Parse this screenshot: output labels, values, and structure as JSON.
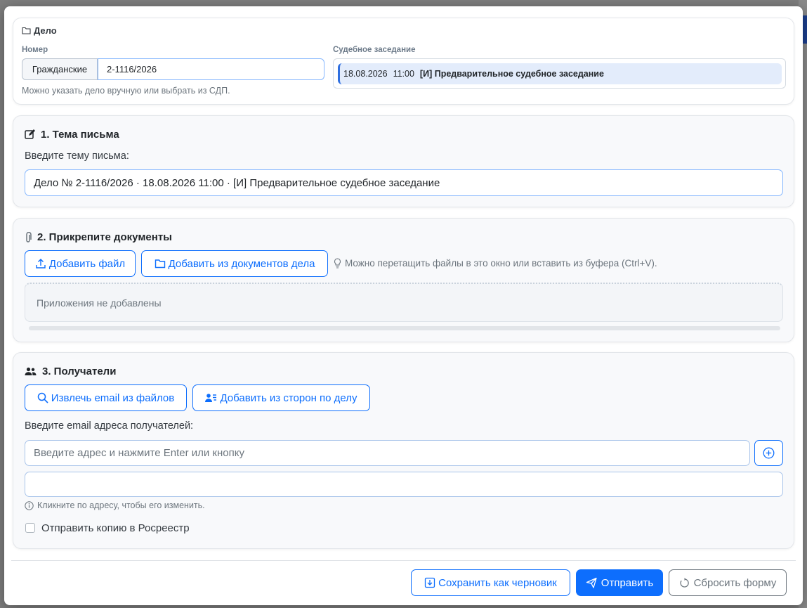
{
  "case": {
    "title": "Дело",
    "number_label": "Номер",
    "case_type": "Гражданские",
    "case_number": "2-1116/2026",
    "hint": "Можно указать дело вручную или выбрать из СДП.",
    "hearing_label": "Судебное заседание",
    "hearing": {
      "date": "18.08.2026",
      "time": "11:00",
      "name": "[И] Предварительное судебное заседание"
    }
  },
  "subject": {
    "title": "1. Тема письма",
    "label": "Введите тему письма:",
    "value": "Дело № 2-1116/2026 · 18.08.2026 11:00 · [И] Предварительное судебное заседание"
  },
  "attachments": {
    "title": "2. Прикрепите документы",
    "add_file": "Добавить файл",
    "add_from_case": "Добавить из документов дела",
    "tip": "Можно перетащить файлы в это окно или вставить из буфера (Ctrl+V).",
    "empty": "Приложения не добавлены"
  },
  "recipients": {
    "title": "3. Получатели",
    "extract_email": "Извлечь email из файлов",
    "add_from_parties": "Добавить из сторон по делу",
    "label": "Введите email адреса получателей:",
    "placeholder": "Введите адрес и нажмите Enter или кнопку",
    "edit_hint": "Кликните по адресу, чтобы его изменить.",
    "rosreestr": "Отправить копию в Росреестр"
  },
  "footer": {
    "save_draft": "Сохранить как черновик",
    "send": "Отправить",
    "reset": "Сбросить форму"
  },
  "colors": {
    "primary": "#0d6efd",
    "secondary": "#6c757d"
  }
}
